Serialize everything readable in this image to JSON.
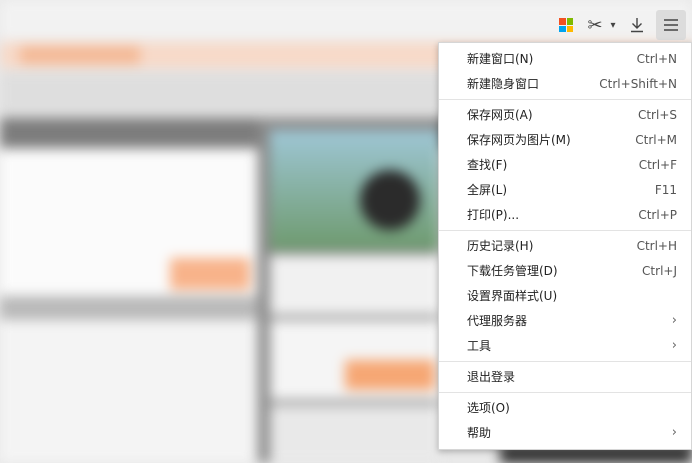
{
  "toolbar": {
    "ms_colors": [
      "#f25022",
      "#7fba00",
      "#00a4ef",
      "#ffb900"
    ],
    "scissors_icon": "✂",
    "caret": "▾"
  },
  "menu": {
    "items": [
      {
        "label": "新建窗口(N)",
        "shortcut": "Ctrl+N"
      },
      {
        "label": "新建隐身窗口",
        "shortcut": "Ctrl+Shift+N"
      },
      {
        "label": "保存网页(A)",
        "shortcut": "Ctrl+S"
      },
      {
        "label": "保存网页为图片(M)",
        "shortcut": "Ctrl+M"
      },
      {
        "label": "查找(F)",
        "shortcut": "Ctrl+F"
      },
      {
        "label": "全屏(L)",
        "shortcut": "F11"
      },
      {
        "label": "打印(P)...",
        "shortcut": "Ctrl+P"
      },
      {
        "label": "历史记录(H)",
        "shortcut": "Ctrl+H"
      },
      {
        "label": "下载任务管理(D)",
        "shortcut": "Ctrl+J"
      },
      {
        "label": "设置界面样式(U)",
        "shortcut": ""
      },
      {
        "label": "代理服务器",
        "submenu": "›"
      },
      {
        "label": "工具",
        "submenu": "›"
      },
      {
        "label": "退出登录",
        "shortcut": ""
      },
      {
        "label": "选项(O)",
        "shortcut": ""
      },
      {
        "label": "帮助",
        "submenu": "›"
      }
    ]
  }
}
